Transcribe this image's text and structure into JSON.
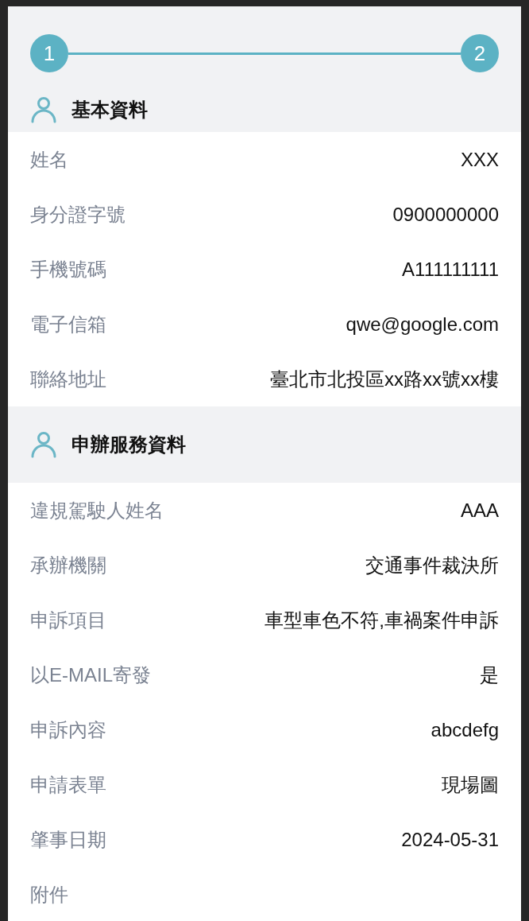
{
  "stepper": {
    "steps": [
      {
        "label": "1",
        "done": true
      },
      {
        "label": "2",
        "done": true
      }
    ]
  },
  "sections": [
    {
      "title": "基本資料",
      "rows": [
        {
          "label": "姓名",
          "value": "XXX"
        },
        {
          "label": "身分證字號",
          "value": "0900000000"
        },
        {
          "label": "手機號碼",
          "value": "A111111111"
        },
        {
          "label": "電子信箱",
          "value": "qwe@google.com"
        },
        {
          "label": "聯絡地址",
          "value": "臺北市北投區xx路xx號xx樓"
        }
      ]
    },
    {
      "title": "申辦服務資料",
      "rows": [
        {
          "label": "違規駕駛人姓名",
          "value": "AAA"
        },
        {
          "label": "承辦機關",
          "value": "交通事件裁決所"
        },
        {
          "label": "申訴項目",
          "value": "車型車色不符,車禍案件申訴"
        },
        {
          "label": "以E-MAIL寄發",
          "value": "是"
        },
        {
          "label": "申訴內容",
          "value": "abcdefg"
        },
        {
          "label": "申請表單",
          "value": "現場圖"
        },
        {
          "label": "肇事日期",
          "value": "2024-05-31"
        },
        {
          "label": "附件"
        }
      ]
    }
  ]
}
